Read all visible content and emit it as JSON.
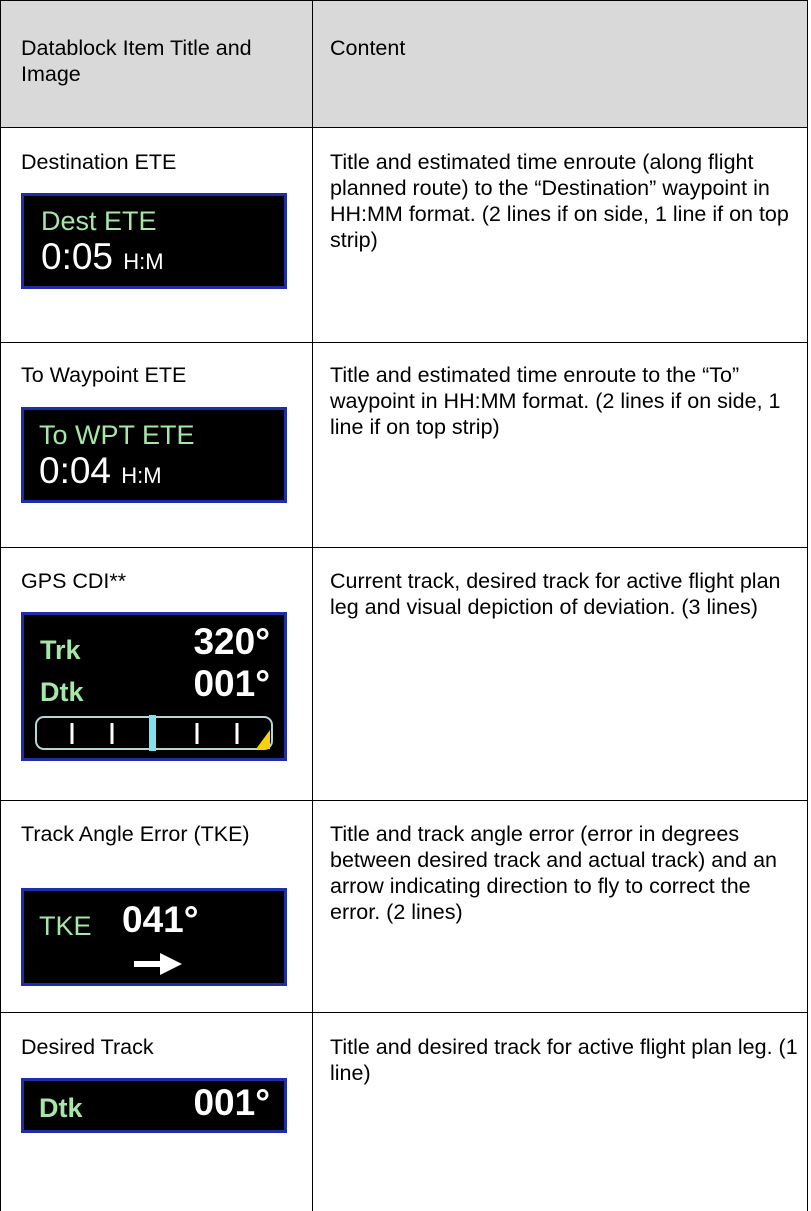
{
  "header": {
    "col1": "Datablock Item Title and Image",
    "col2": "Content"
  },
  "rows": [
    {
      "title": "Destination ETE",
      "content": "Title and estimated time enroute (along flight planned route) to the “Destination” waypoint in HH:MM format. (2 lines if on side, 1 line if on top strip)",
      "display": {
        "label": "Dest ETE",
        "value": "0:05",
        "unit": "H:M"
      }
    },
    {
      "title": "To Waypoint ETE",
      "content": "Title and estimated time enroute to the “To” waypoint in HH:MM format. (2 lines if on side, 1 line if on top strip)",
      "display": {
        "label": "To WPT ETE",
        "value": "0:04",
        "unit": "H:M"
      }
    },
    {
      "title": "GPS CDI**",
      "content": "Current track, desired track for active flight plan leg and visual depiction of deviation. (3 lines)",
      "display": {
        "trk_label": "Trk",
        "trk_value": "320°",
        "dtk_label": "Dtk",
        "dtk_value": "001°"
      }
    },
    {
      "title": "Track Angle Error (TKE)",
      "content": "Title and track angle error (error in degrees between desired track and actual track) and an arrow indicating direction to fly to correct the error. (2 lines)",
      "display": {
        "label": "TKE",
        "value": "041°"
      }
    },
    {
      "title": "Desired Track",
      "content": "Title and desired track for active flight plan leg. (1 line)",
      "display": {
        "label": "Dtk",
        "value": "001°"
      }
    }
  ],
  "colors": {
    "display_bg": "#000000",
    "display_border": "#1d2ea8",
    "label_green": "#a6e6a6",
    "value_white": "#ffffff",
    "cdi_needle": "#7fe3f0",
    "cdi_flag": "#f5d20a",
    "header_bg": "#d9d9d9"
  }
}
